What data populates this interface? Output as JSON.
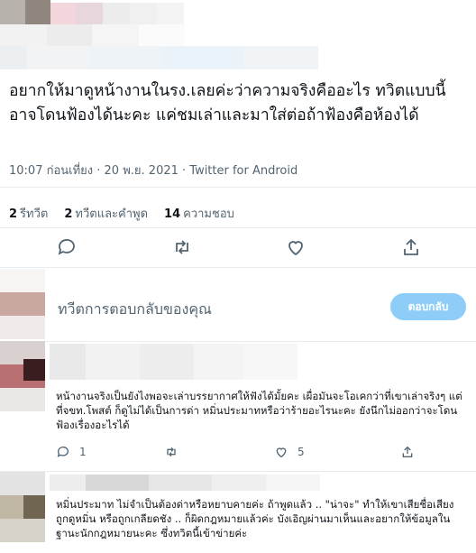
{
  "tweet": {
    "text": "อยากให้มาดูหน้างานในรง.เลยค่ะว่าความจริงคืออะไร ทวิตแบบนี้อาจโดนฟ้องได้นะคะ แค่ชมเล่าและมาใส่ต่อถ้าฟ้องคือห้องได้",
    "meta": "10:07 ก่อนเที่ยง · 20 พ.ย. 2021 · Twitter for Android"
  },
  "stats": {
    "retweets_count": "2",
    "retweets_label": "รีทวีต",
    "quotes_count": "2",
    "quotes_label": "ทวีตและคำพูด",
    "likes_count": "14",
    "likes_label": "ความชอบ"
  },
  "actions": {
    "reply_icon": "comment-icon",
    "retweet_icon": "retweet-icon",
    "like_icon": "heart-icon",
    "share_icon": "share-icon"
  },
  "compose": {
    "placeholder": "ทวีตการตอบกลับของคุณ",
    "reply_button": "ตอบกลับ"
  },
  "replies": [
    {
      "text": "หน้างานจริงเป็นยังไงพอจะเล่าบรรยากาศให้ฟังได้มั้ยคะ เผื่อมันจะโอเคกว่าที่เขาเล่าจริงๆ แต่ที่จขท.โพสต์ ก็ดูไม่ได้เป็นการด่า หมิ่นประมาทหรือว่าร้ายอะไรนะคะ ยังนึกไม่ออกว่าจะโดนฟ้องเรื่องอะไรได้",
      "reply_count": "1",
      "like_count": "5"
    },
    {
      "text": "หมิ่นประมาท ไม่จำเป็นต้องด่าหรือหยาบคายค่ะ ถ้าพูดแล้ว .. \"น่าจะ\" ทำให้เขาเสียชื่อเสียง ถูกดูหมิ่น หรือถูกเกลียดชัง .. ก็ผิดกฎหมายแล้วค่ะ บังเอิญผ่านมาเห็นและอยากให้ข้อมูลในฐานะนักกฎหมายนะคะ ซึ่งทวิตนี้เข้าข่ายค่ะ"
    }
  ],
  "colors": {
    "accent": "#1d9bf0",
    "reply_button_bg": "#8ecdf8",
    "muted_text": "#536471",
    "divider": "#e6ecf0"
  }
}
